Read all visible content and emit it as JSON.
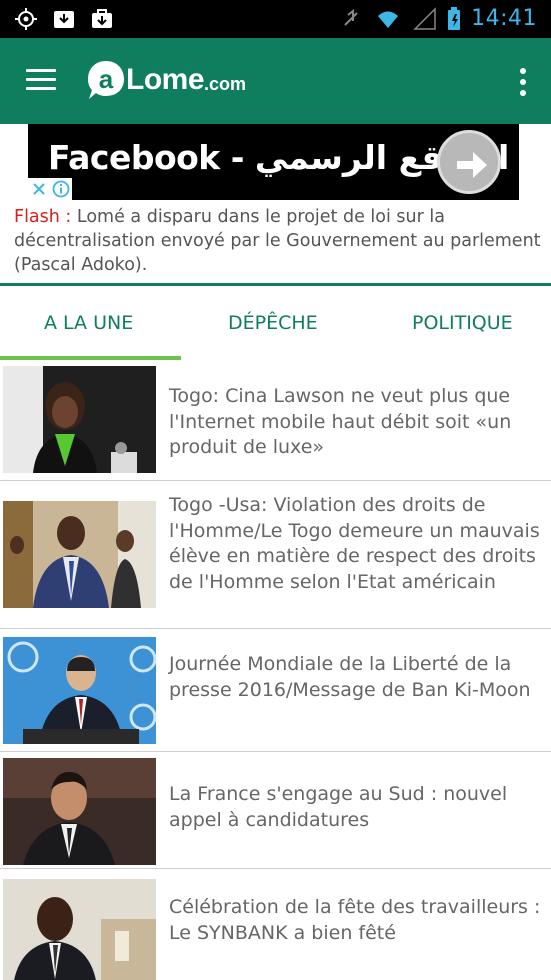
{
  "status_bar": {
    "time": "14:41",
    "left_icons": [
      "gps-icon",
      "download-icon",
      "bag-icon"
    ],
    "right_icons": [
      "mute-icon",
      "wifi-icon",
      "signal-icon",
      "battery-icon"
    ]
  },
  "app_bar": {
    "logo_text": "Lome",
    "logo_suffix": ".com",
    "menu_icon": "hamburger-menu-icon",
    "overflow_icon": "more-vert-icon",
    "color": "#0f7e5e"
  },
  "ad": {
    "text": "Facebook - الموقع الرسمي",
    "arrow_icon": "arrow-right-icon"
  },
  "flash": {
    "label": "Flash :",
    "text": "Lomé a disparu dans le projet de loi sur la décentralisation envoyé par le Gouvernement au parlement (Pascal Adoko)."
  },
  "tabs": [
    {
      "label": "A LA UNE",
      "active": true
    },
    {
      "label": "DÉPÊCHE",
      "active": false
    },
    {
      "label": "POLITIQUE",
      "active": false
    }
  ],
  "articles": [
    {
      "title": "Togo: Cina Lawson ne veut plus que l'Internet mobile haut débit soit «un produit de luxe»"
    },
    {
      "title": "Togo -Usa: Violation des droits de l'Homme/Le Togo demeure un mauvais élève en matière de respect des droits de l'Homme selon l'Etat américain"
    },
    {
      "title": "Journée Mondiale de la Liberté de la presse 2016/Message de Ban Ki-Moon"
    },
    {
      "title": "La France s'engage au Sud : nouvel appel à candidatures"
    },
    {
      "title": "Célébration de la fête des travailleurs : Le SYNBANK a bien fêté"
    }
  ],
  "colors": {
    "brand": "#0f7e5e",
    "flash": "#d8201a",
    "tab_indicator": "#6cc24a"
  }
}
